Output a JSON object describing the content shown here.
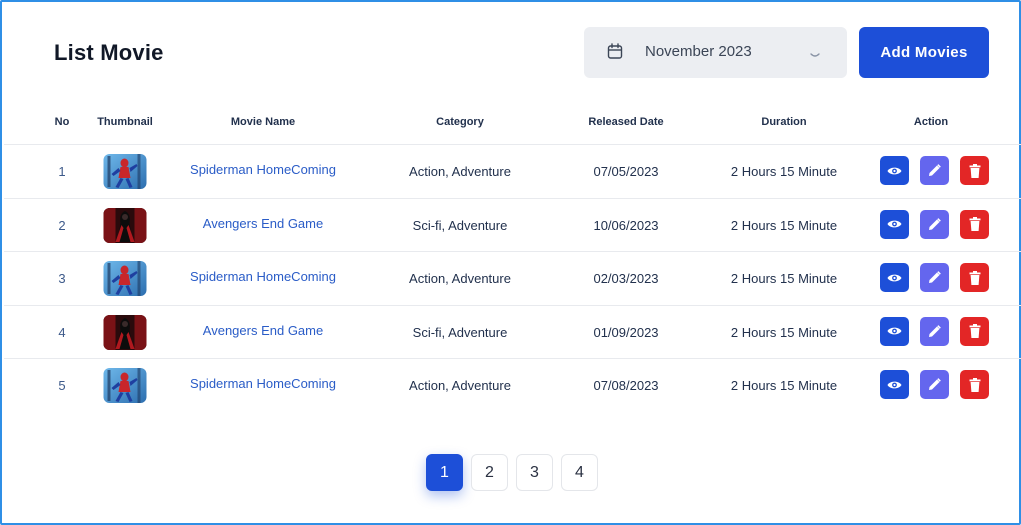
{
  "header": {
    "title": "List Movie",
    "month_select": {
      "value": "November 2023",
      "icon": "calendar-icon",
      "chevron": "chevron-down-icon"
    },
    "add_button_label": "Add Movies"
  },
  "colors": {
    "primary": "#1d4fd8",
    "edit": "#6466ee",
    "delete": "#e32626",
    "link": "#2a5cc7"
  },
  "table": {
    "columns": [
      "No",
      "Thumbnail",
      "Movie Name",
      "Category",
      "Released Date",
      "Duration",
      "Action"
    ],
    "rows": [
      {
        "no": "1",
        "thumbnail": "spiderman-poster",
        "name": "Spiderman HomeComing",
        "category": "Action, Adventure",
        "released": "07/05/2023",
        "duration": "2 Hours 15 Minute"
      },
      {
        "no": "2",
        "thumbnail": "avengers-poster",
        "name": "Avengers End Game",
        "category": "Sci-fi, Adventure",
        "released": "10/06/2023",
        "duration": "2 Hours 15 Minute"
      },
      {
        "no": "3",
        "thumbnail": "spiderman-poster",
        "name": "Spiderman HomeComing",
        "category": "Action, Adventure",
        "released": "02/03/2023",
        "duration": "2 Hours 15 Minute"
      },
      {
        "no": "4",
        "thumbnail": "avengers-poster",
        "name": "Avengers End Game",
        "category": "Sci-fi, Adventure",
        "released": "01/09/2023",
        "duration": "2 Hours 15 Minute"
      },
      {
        "no": "5",
        "thumbnail": "spiderman-poster",
        "name": "Spiderman HomeComing",
        "category": "Action, Adventure",
        "released": "07/08/2023",
        "duration": "2 Hours 15 Minute"
      }
    ],
    "actions": [
      "eye-icon",
      "pencil-icon",
      "trash-icon"
    ]
  },
  "pagination": {
    "pages": [
      "1",
      "2",
      "3",
      "4"
    ],
    "current": "1"
  }
}
